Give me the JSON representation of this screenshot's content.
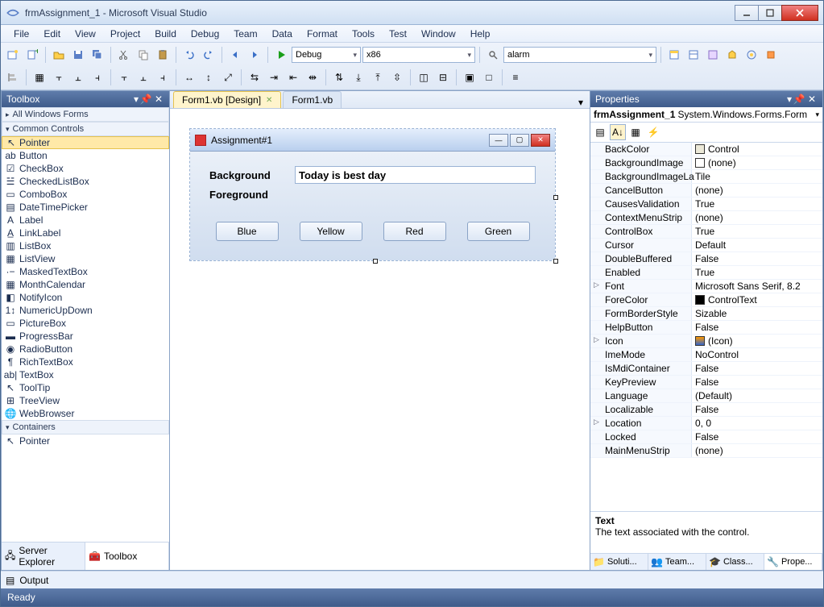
{
  "window": {
    "title": "frmAssignment_1 - Microsoft Visual Studio"
  },
  "menu": [
    "File",
    "Edit",
    "View",
    "Project",
    "Build",
    "Debug",
    "Team",
    "Data",
    "Format",
    "Tools",
    "Test",
    "Window",
    "Help"
  ],
  "toolbar": {
    "config": "Debug",
    "platform": "x86",
    "search": "alarm"
  },
  "toolbox": {
    "title": "Toolbox",
    "groups": {
      "allForms": "All Windows Forms",
      "common": "Common Controls",
      "containers": "Containers"
    },
    "commonItems": [
      "Pointer",
      "Button",
      "CheckBox",
      "CheckedListBox",
      "ComboBox",
      "DateTimePicker",
      "Label",
      "LinkLabel",
      "ListBox",
      "ListView",
      "MaskedTextBox",
      "MonthCalendar",
      "NotifyIcon",
      "NumericUpDown",
      "PictureBox",
      "ProgressBar",
      "RadioButton",
      "RichTextBox",
      "TextBox",
      "ToolTip",
      "TreeView",
      "WebBrowser"
    ],
    "containerItems": [
      "Pointer"
    ],
    "bottomTabs": {
      "server": "Server Explorer",
      "toolbox": "Toolbox"
    }
  },
  "tabs": {
    "design": "Form1.vb [Design]",
    "code": "Form1.vb"
  },
  "form": {
    "title": "Assignment#1",
    "lblBackground": "Background",
    "lblForeground": "Foreground",
    "textbox": "Today is best day",
    "buttons": [
      "Blue",
      "Yellow",
      "Red",
      "Green"
    ]
  },
  "properties": {
    "title": "Properties",
    "selectedName": "frmAssignment_1",
    "selectedType": "System.Windows.Forms.Form",
    "rows": [
      {
        "n": "BackColor",
        "v": "Control",
        "swatch": "#ece9d8"
      },
      {
        "n": "BackgroundImage",
        "v": "(none)",
        "swatch": "#ffffff"
      },
      {
        "n": "BackgroundImageLa",
        "v": "Tile"
      },
      {
        "n": "CancelButton",
        "v": "(none)"
      },
      {
        "n": "CausesValidation",
        "v": "True"
      },
      {
        "n": "ContextMenuStrip",
        "v": "(none)"
      },
      {
        "n": "ControlBox",
        "v": "True"
      },
      {
        "n": "Cursor",
        "v": "Default"
      },
      {
        "n": "DoubleBuffered",
        "v": "False"
      },
      {
        "n": "Enabled",
        "v": "True"
      },
      {
        "n": "Font",
        "v": "Microsoft Sans Serif, 8.2",
        "exp": "▷"
      },
      {
        "n": "ForeColor",
        "v": "ControlText",
        "swatch": "#000000"
      },
      {
        "n": "FormBorderStyle",
        "v": "Sizable"
      },
      {
        "n": "HelpButton",
        "v": "False"
      },
      {
        "n": "Icon",
        "v": "(Icon)",
        "exp": "▷",
        "iconSwatch": true
      },
      {
        "n": "ImeMode",
        "v": "NoControl"
      },
      {
        "n": "IsMdiContainer",
        "v": "False"
      },
      {
        "n": "KeyPreview",
        "v": "False"
      },
      {
        "n": "Language",
        "v": "(Default)"
      },
      {
        "n": "Localizable",
        "v": "False"
      },
      {
        "n": "Location",
        "v": "0, 0",
        "exp": "▷"
      },
      {
        "n": "Locked",
        "v": "False"
      },
      {
        "n": "MainMenuStrip",
        "v": "(none)"
      }
    ],
    "desc": {
      "title": "Text",
      "body": "The text associated with the control."
    },
    "bottomTabs": [
      "Soluti...",
      "Team...",
      "Class...",
      "Prope..."
    ]
  },
  "output": {
    "label": "Output"
  },
  "status": {
    "text": "Ready"
  }
}
